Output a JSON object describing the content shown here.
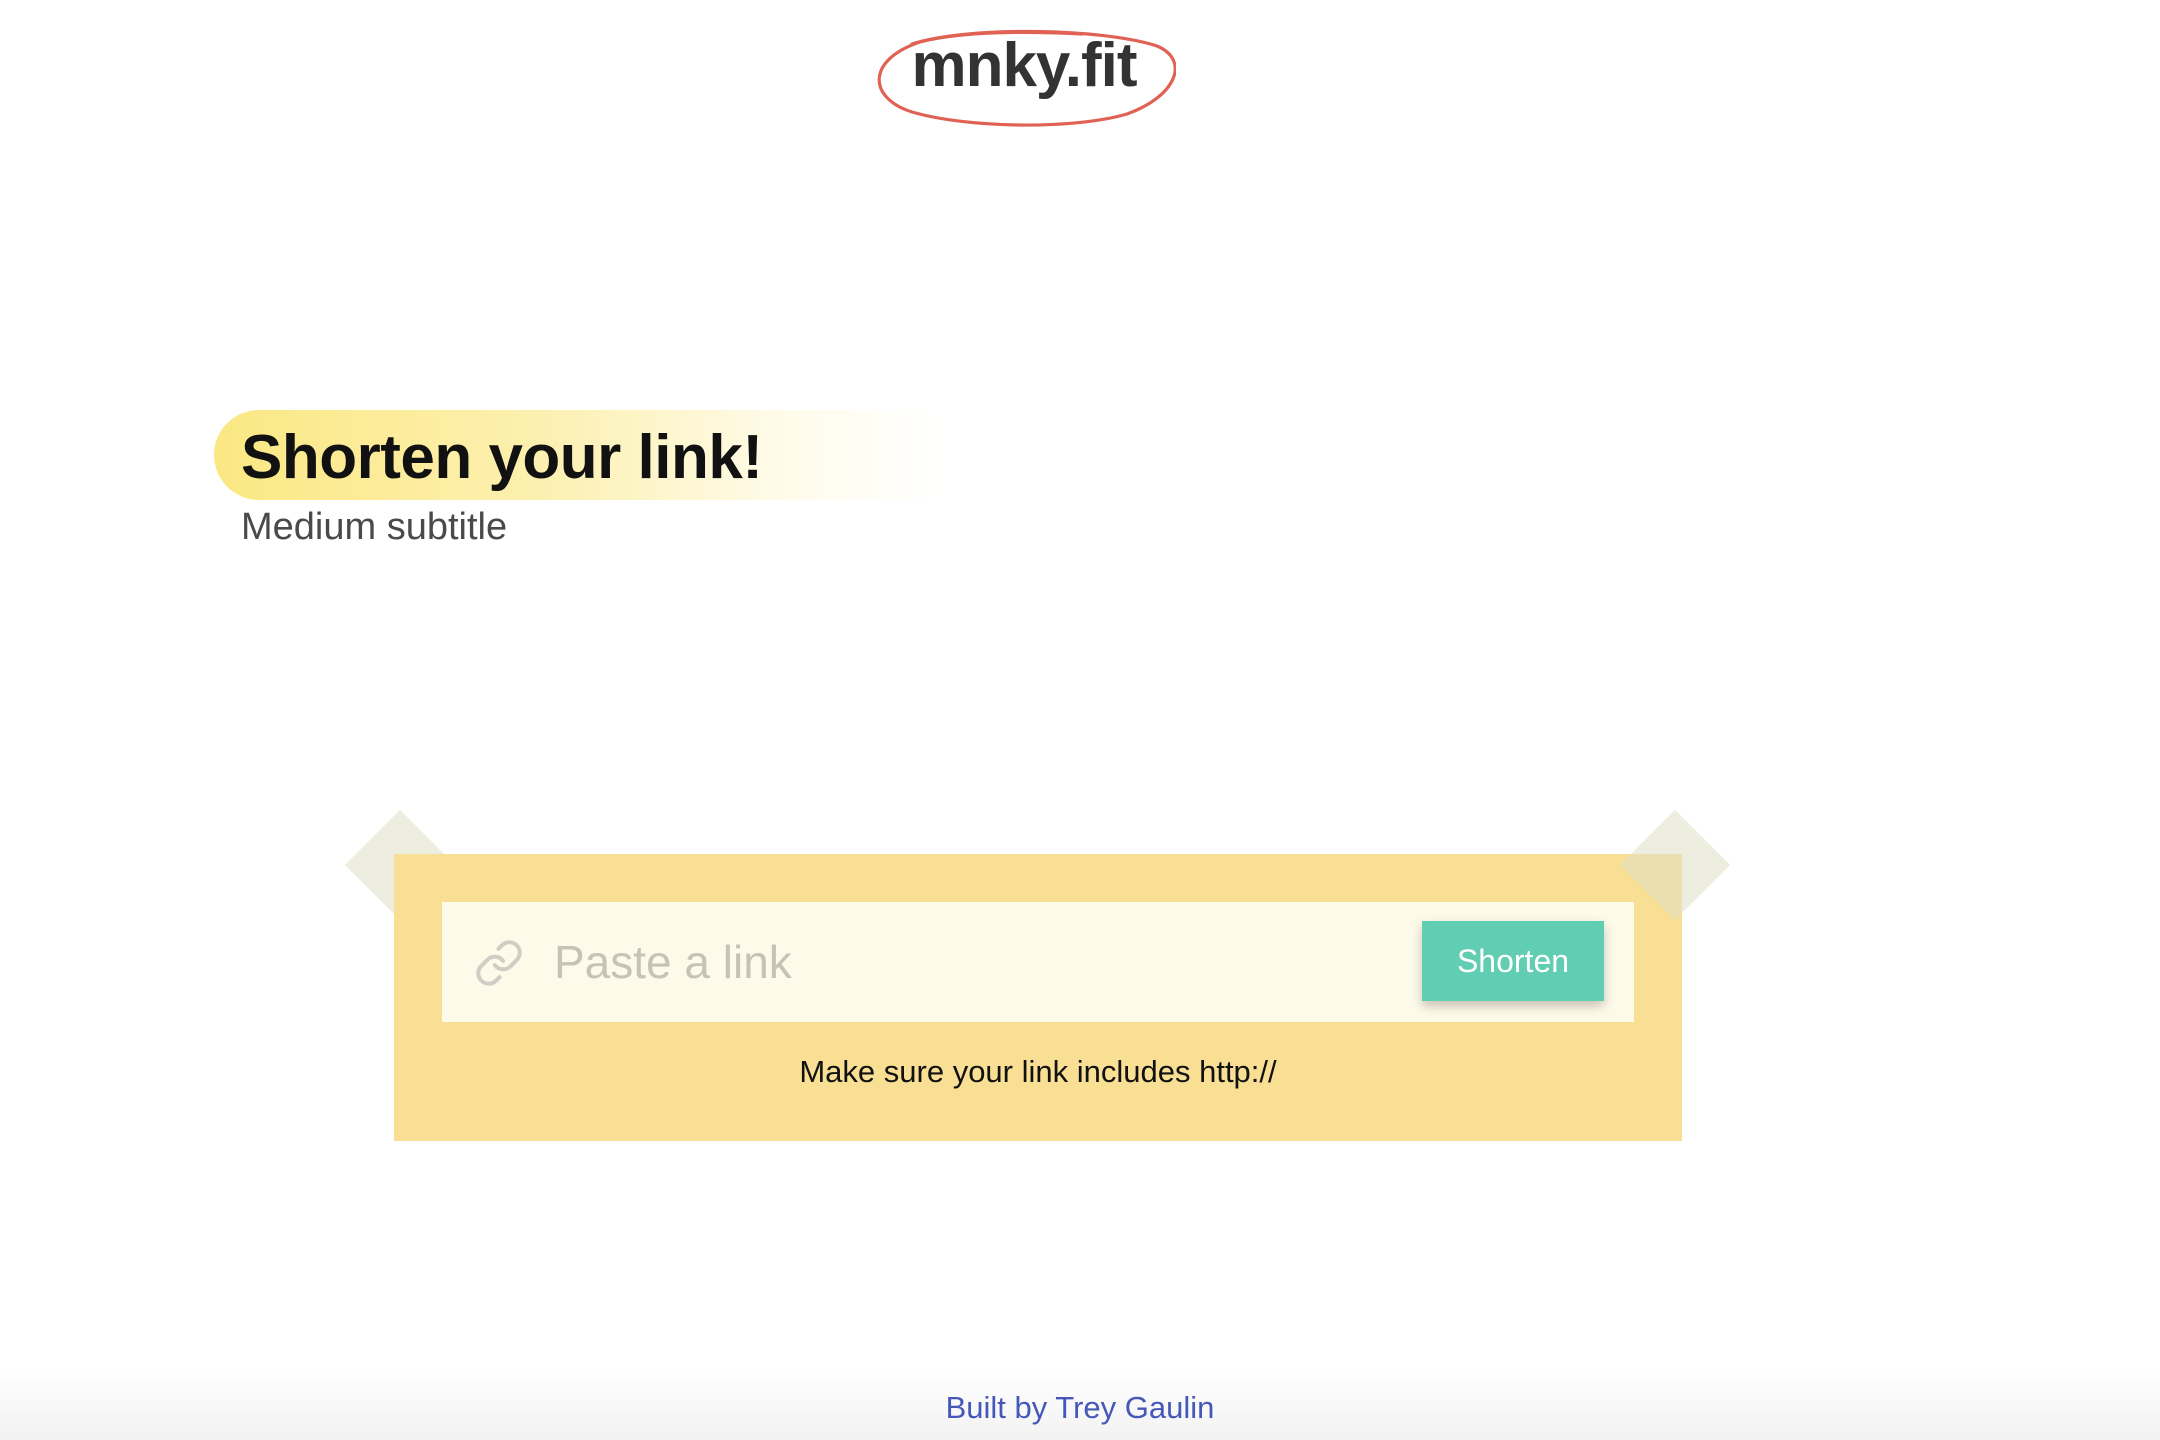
{
  "logo": {
    "text": "mnky.fit",
    "ring_color": "#e06255"
  },
  "hero": {
    "title": "Shorten your link!",
    "subtitle": "Medium subtitle",
    "highlight_color": "#fbe883"
  },
  "form": {
    "icon": "link-icon",
    "input_placeholder": "Paste a link",
    "input_value": "",
    "button_label": "Shorten",
    "button_color": "#61cdb3",
    "hint": "Make sure your link includes http://",
    "card_color": "#f9df93"
  },
  "footer": {
    "credit": "Built by Trey Gaulin",
    "link_color": "#4558b8"
  }
}
